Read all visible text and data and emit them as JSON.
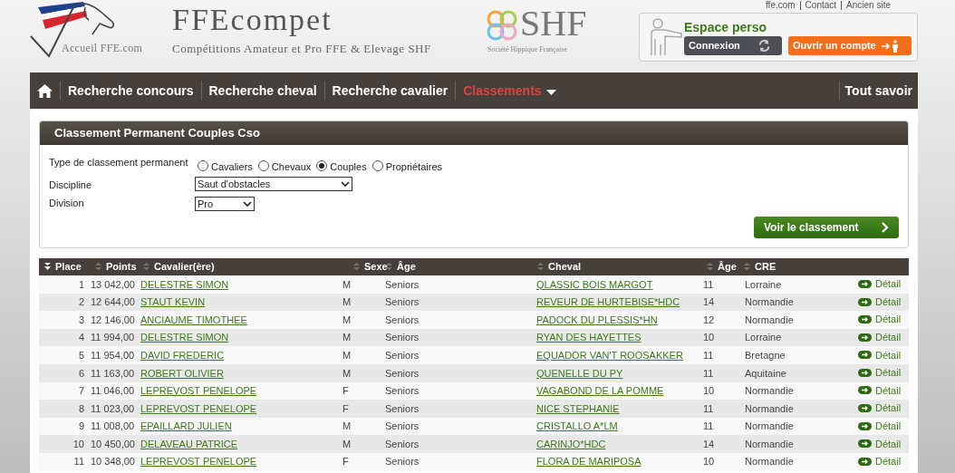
{
  "header": {
    "home_link": "Accueil FFE.com",
    "site_title": "FFEcompet",
    "site_subtitle": "Compétitions Amateur et Pro FFE & Elevage SHF",
    "partner_name": "SHF",
    "partner_caption": "Société Hippique Française",
    "top_links": [
      "ffe.com",
      "Contact",
      "Ancien site"
    ],
    "account": {
      "title": "Espace perso",
      "login_button": "Connexion",
      "signup_button": "Ouvrir un compte"
    }
  },
  "nav": {
    "items": [
      {
        "label": "Recherche concours",
        "selected": false,
        "dropdown": false
      },
      {
        "label": "Recherche cheval",
        "selected": false,
        "dropdown": false
      },
      {
        "label": "Recherche cavalier",
        "selected": false,
        "dropdown": false
      },
      {
        "label": "Classements",
        "selected": true,
        "dropdown": true
      }
    ],
    "right_item": "Tout savoir"
  },
  "form": {
    "title": "Classement Permanent Couples Cso",
    "type_label": "Type de classement permanent",
    "type_options": [
      {
        "label": "Cavaliers",
        "selected": false
      },
      {
        "label": "Chevaux",
        "selected": false
      },
      {
        "label": "Couples",
        "selected": true
      },
      {
        "label": "Propriétaires",
        "selected": false
      }
    ],
    "discipline_label": "Discipline",
    "discipline_value": "Saut d'obstacles",
    "division_label": "Division",
    "division_value": "Pro",
    "submit": "Voir le classement"
  },
  "table": {
    "columns": [
      {
        "label": "Place",
        "sorted": true
      },
      {
        "label": "Points",
        "sorted": false
      },
      {
        "label": "Cavalier(ère)",
        "sorted": false
      },
      {
        "label": "Sexe",
        "sorted": false
      },
      {
        "label": "Âge",
        "sorted": false
      },
      {
        "label": "Cheval",
        "sorted": false
      },
      {
        "label": "Âge",
        "sorted": false
      },
      {
        "label": "CRE",
        "sorted": false
      }
    ],
    "rows": [
      {
        "place": "1",
        "points": "13 042,00",
        "rider": "DELESTRE SIMON",
        "sex": "M",
        "age": "Seniors",
        "horse": "QLASSIC BOIS MARGOT",
        "horse_age": "11",
        "cre": "Lorraine",
        "detail": "Détail"
      },
      {
        "place": "2",
        "points": "12 644,00",
        "rider": "STAUT KEVIN",
        "sex": "M",
        "age": "Seniors",
        "horse": "REVEUR DE HURTEBISE*HDC",
        "horse_age": "14",
        "cre": "Normandie",
        "detail": "Détail"
      },
      {
        "place": "3",
        "points": "12 146,00",
        "rider": "ANCIAUME TIMOTHEE",
        "sex": "M",
        "age": "Seniors",
        "horse": "PADOCK DU PLESSIS*HN",
        "horse_age": "12",
        "cre": "Normandie",
        "detail": "Détail"
      },
      {
        "place": "4",
        "points": "11 994,00",
        "rider": "DELESTRE SIMON",
        "sex": "M",
        "age": "Seniors",
        "horse": "RYAN DES HAYETTES",
        "horse_age": "10",
        "cre": "Lorraine",
        "detail": "Détail"
      },
      {
        "place": "5",
        "points": "11 954,00",
        "rider": "DAVID FREDERIC",
        "sex": "M",
        "age": "Seniors",
        "horse": "EQUADOR VAN'T ROOSAKKER",
        "horse_age": "11",
        "cre": "Bretagne",
        "detail": "Détail"
      },
      {
        "place": "6",
        "points": "11 163,00",
        "rider": "ROBERT OLIVIER",
        "sex": "M",
        "age": "Seniors",
        "horse": "QUENELLE DU PY",
        "horse_age": "11",
        "cre": "Aquitaine",
        "detail": "Détail"
      },
      {
        "place": "7",
        "points": "11 046,00",
        "rider": "LEPREVOST PENELOPE",
        "sex": "F",
        "age": "Seniors",
        "horse": "VAGABOND DE LA POMME",
        "horse_age": "10",
        "cre": "Normandie",
        "detail": "Détail"
      },
      {
        "place": "8",
        "points": "11 023,00",
        "rider": "LEPREVOST PENELOPE",
        "sex": "F",
        "age": "Seniors",
        "horse": "NICE STEPHANIE",
        "horse_age": "11",
        "cre": "Normandie",
        "detail": "Détail"
      },
      {
        "place": "9",
        "points": "11 008,00",
        "rider": "EPAILLARD JULIEN",
        "sex": "M",
        "age": "Seniors",
        "horse": "CRISTALLO A*LM",
        "horse_age": "11",
        "cre": "Normandie",
        "detail": "Détail"
      },
      {
        "place": "10",
        "points": "10 450,00",
        "rider": "DELAVEAU PATRICE",
        "sex": "M",
        "age": "Seniors",
        "horse": "CARINJO*HDC",
        "horse_age": "14",
        "cre": "Normandie",
        "detail": "Détail"
      },
      {
        "place": "11",
        "points": "10 348,00",
        "rider": "LEPREVOST PENELOPE",
        "sex": "F",
        "age": "Seniors",
        "horse": "FLORA DE MARIPOSA",
        "horse_age": "10",
        "cre": "Normandie",
        "detail": "Détail"
      }
    ]
  }
}
